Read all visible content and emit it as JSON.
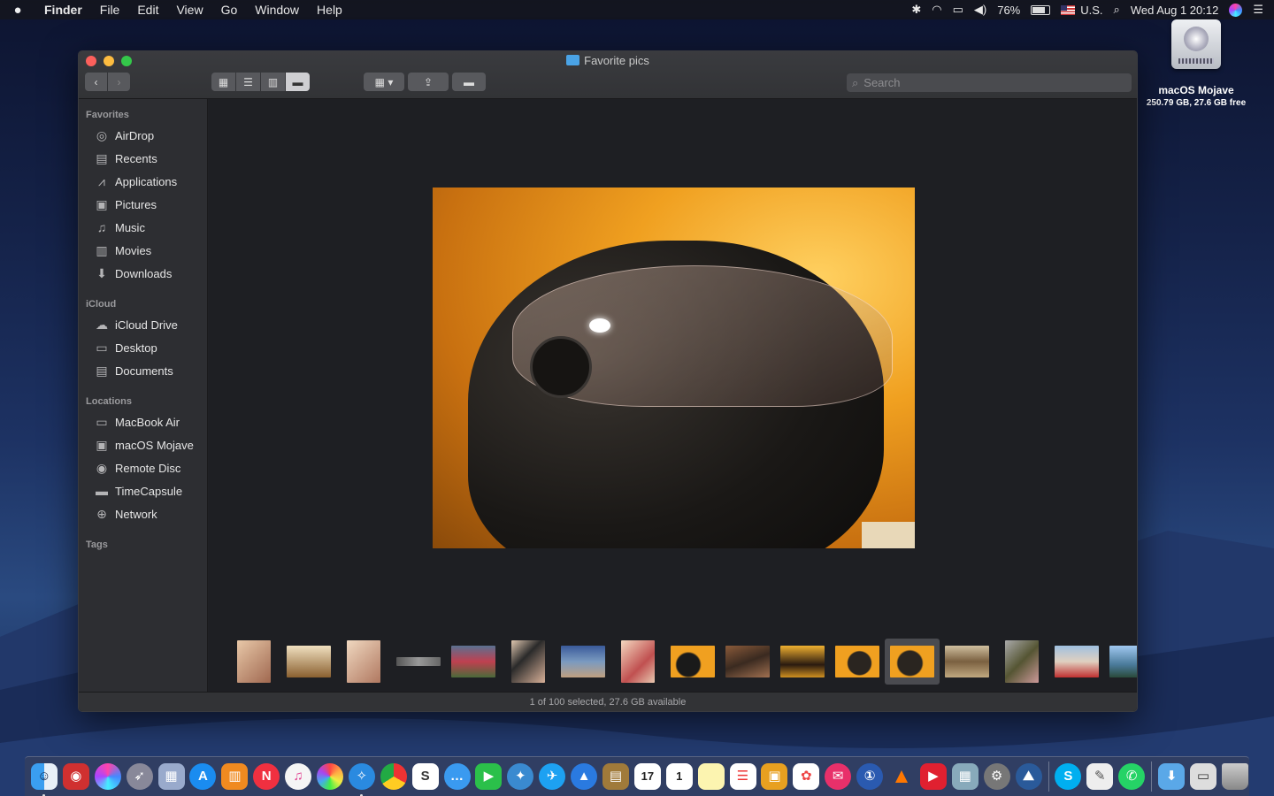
{
  "menubar": {
    "app_name": "Finder",
    "menus": [
      "File",
      "Edit",
      "View",
      "Go",
      "Window",
      "Help"
    ],
    "battery": "76%",
    "input_source": "U.S.",
    "clock": "Wed Aug 1  20:12"
  },
  "desktop": {
    "disk": {
      "name": "macOS Mojave",
      "info": "250.79 GB, 27.6 GB free"
    }
  },
  "window": {
    "title": "Favorite pics",
    "search": {
      "placeholder": "Search"
    },
    "view_buttons": [
      "icon-view",
      "list-view",
      "column-view",
      "gallery-view"
    ],
    "active_view": "gallery-view",
    "status": "1 of 100 selected, 27.6 GB available"
  },
  "sidebar": {
    "favorites_label": "Favorites",
    "favorites": [
      {
        "label": "AirDrop",
        "icon": "airdrop-icon"
      },
      {
        "label": "Recents",
        "icon": "recents-icon"
      },
      {
        "label": "Applications",
        "icon": "applications-icon"
      },
      {
        "label": "Pictures",
        "icon": "pictures-icon"
      },
      {
        "label": "Music",
        "icon": "music-icon"
      },
      {
        "label": "Movies",
        "icon": "movies-icon"
      },
      {
        "label": "Downloads",
        "icon": "downloads-icon"
      }
    ],
    "icloud_label": "iCloud",
    "icloud": [
      {
        "label": "iCloud Drive",
        "icon": "cloud-icon"
      },
      {
        "label": "Desktop",
        "icon": "desktop-icon"
      },
      {
        "label": "Documents",
        "icon": "documents-icon"
      }
    ],
    "locations_label": "Locations",
    "locations": [
      {
        "label": "MacBook Air",
        "icon": "laptop-icon"
      },
      {
        "label": "macOS Mojave",
        "icon": "disk-icon"
      },
      {
        "label": "Remote Disc",
        "icon": "disc-icon"
      },
      {
        "label": "TimeCapsule",
        "icon": "timecapsule-icon"
      },
      {
        "label": "Network",
        "icon": "network-icon"
      }
    ],
    "tags_label": "Tags"
  },
  "gallery": {
    "selected_index": 12,
    "thumb_count": 17
  },
  "colors": {
    "accent": "#4aa3e6",
    "close": "#fc605c",
    "minimize": "#fdbc40",
    "zoom": "#34c84a"
  },
  "dock": {
    "apps": [
      "finder-icon",
      "photo-booth-icon",
      "siri-icon",
      "launchpad-icon",
      "preview-icon",
      "app-store-icon",
      "books-icon",
      "news-icon",
      "itunes-icon",
      "photos-icon",
      "safari-icon",
      "chrome-icon",
      "slack-icon",
      "messages-icon",
      "facetime-icon",
      "tweetbot-icon",
      "twitter-icon",
      "maps-icon",
      "notefile-icon",
      "calendar-icon",
      "reminders-calendar-icon",
      "notes-icon",
      "reminders-icon",
      "keynote-icon",
      "photoscape-icon",
      "airmail-icon",
      "1password-icon",
      "vlc-icon",
      "pdf-icon",
      "preview-doc-icon",
      "system-preferences-icon",
      "nordvpn-icon",
      "skype-icon",
      "textedit-icon",
      "whatsapp-icon",
      "downloads-stack-icon",
      "screenshots-stack-icon",
      "trash-icon"
    ]
  }
}
